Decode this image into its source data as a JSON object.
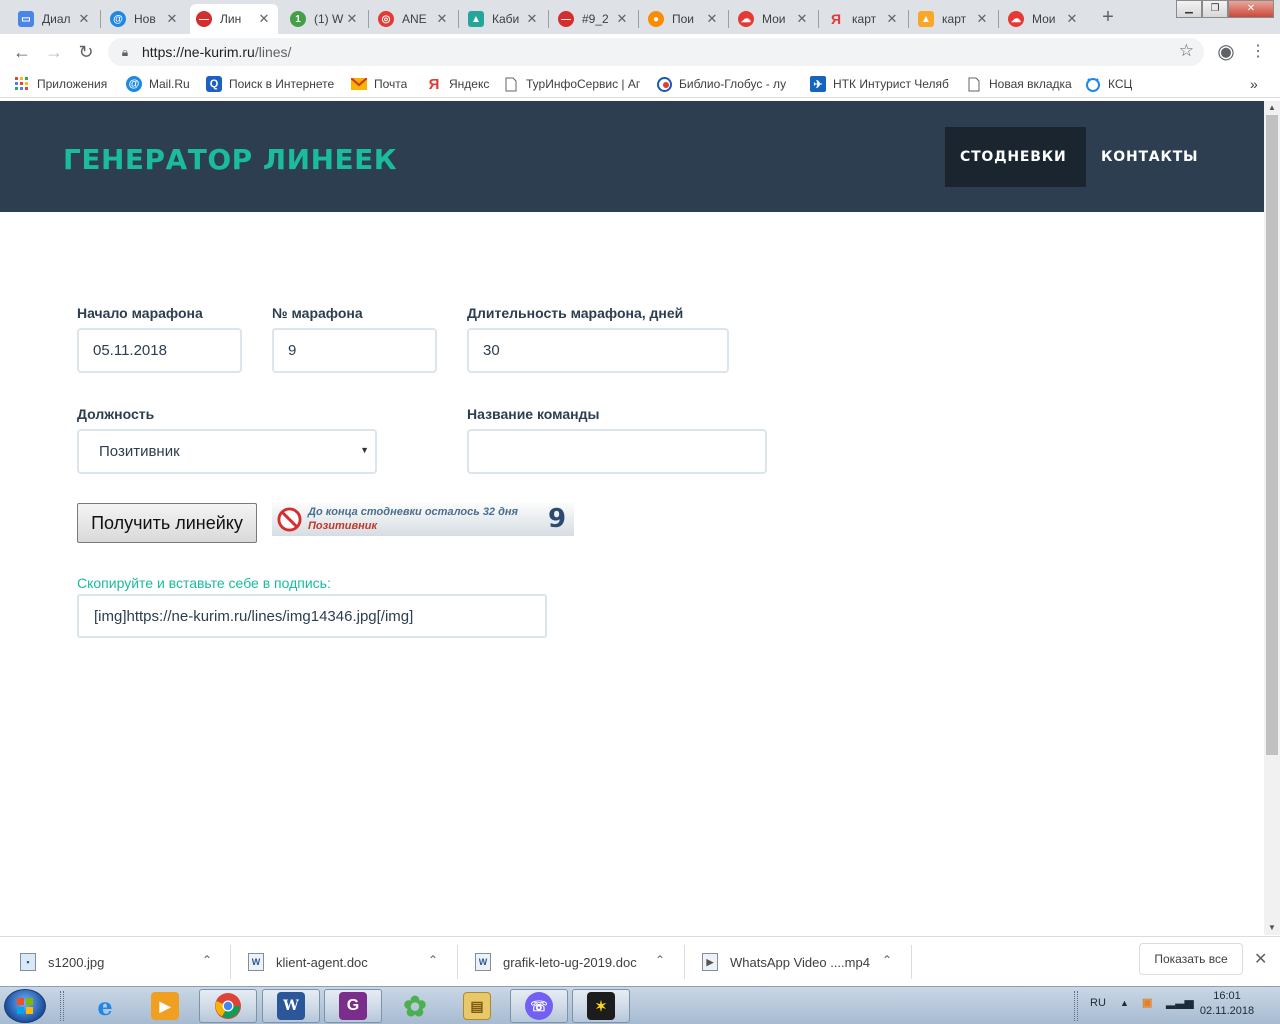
{
  "browser": {
    "tabs": [
      {
        "title": "Диал",
        "icon": "chat-icon",
        "color": "#4a86e8"
      },
      {
        "title": "Нов",
        "icon": "mail-at-icon",
        "color": "#1e88e5"
      },
      {
        "title": "Лин",
        "icon": "no-entry-icon",
        "color": "#d32f2f",
        "active": true
      },
      {
        "title": "(1) W",
        "icon": "whatsapp-icon",
        "color": "#43a047"
      },
      {
        "title": "ANE",
        "icon": "target-icon",
        "color": "#e53935"
      },
      {
        "title": "Каби",
        "icon": "image-icon",
        "color": "#26a69a"
      },
      {
        "title": "#9_2",
        "icon": "no-entry-icon",
        "color": "#d32f2f"
      },
      {
        "title": "Пои",
        "icon": "globe-icon",
        "color": "#fb8c00"
      },
      {
        "title": "Мои",
        "icon": "cloud-icon",
        "color": "#e53935"
      },
      {
        "title": "карт",
        "icon": "yandex-icon",
        "color": "#e53935"
      },
      {
        "title": "карт",
        "icon": "picture-icon",
        "color": "#f9a825"
      },
      {
        "title": "Мои",
        "icon": "cloud-icon",
        "color": "#e53935"
      }
    ],
    "url_host": "https://ne-kurim.ru",
    "url_path": "/lines/",
    "bookmarks": [
      {
        "label": "Приложения",
        "icon": "apps-grid-icon"
      },
      {
        "label": "Mail.Ru",
        "icon": "mail-at-icon"
      },
      {
        "label": "Поиск в Интернете",
        "icon": "search-icon"
      },
      {
        "label": "Почта",
        "icon": "envelope-icon"
      },
      {
        "label": "Яндекс",
        "icon": "yandex-icon"
      },
      {
        "label": "ТурИнфоСервис | Аг",
        "icon": "page-icon"
      },
      {
        "label": "Библио-Глобус - лу",
        "icon": "globe-icon"
      },
      {
        "label": "НТК Интурист Челяб",
        "icon": "plane-icon"
      },
      {
        "label": "Новая вкладка",
        "icon": "page-icon"
      },
      {
        "label": "КСЦ",
        "icon": "ksc-icon"
      }
    ],
    "more_bookmarks": "»"
  },
  "site": {
    "logo": "ГЕНЕРАТОР ЛИНЕЕК",
    "nav": {
      "stodnevki": "СТОДНЕВКИ",
      "contacts": "КОНТАКТЫ"
    },
    "colors": {
      "header_bg": "#2c3e50",
      "accent": "#1abc9c"
    }
  },
  "form": {
    "start_label": "Начало марафона",
    "start_value": "05.11.2018",
    "number_label": "№ марафона",
    "number_value": "9",
    "duration_label": "Длительность марафона, дней",
    "duration_value": "30",
    "role_label": "Должность",
    "role_value": "Позитивник",
    "team_label": "Название команды",
    "team_value": "",
    "submit_label": "Получить линейку",
    "copy_label": "Скопируйте и вставьте себе в подпись:",
    "copy_value": "[img]https://ne-kurim.ru/lines/img14346.jpg[/img]"
  },
  "banner": {
    "line1": "До конца стодневки осталось 32 дня",
    "line2": "Позитивник",
    "number": "9"
  },
  "downloads": {
    "items": [
      {
        "name": "s1200.jpg",
        "icon": "image-file-icon"
      },
      {
        "name": "klient-agent.doc",
        "icon": "word-file-icon"
      },
      {
        "name": "grafik-leto-ug-2019.doc",
        "icon": "word-file-icon"
      },
      {
        "name": "WhatsApp Video ....mp4",
        "icon": "video-file-icon"
      }
    ],
    "show_all": "Показать все"
  },
  "taskbar": {
    "lang": "RU",
    "time": "16:01",
    "date": "02.11.2018"
  }
}
